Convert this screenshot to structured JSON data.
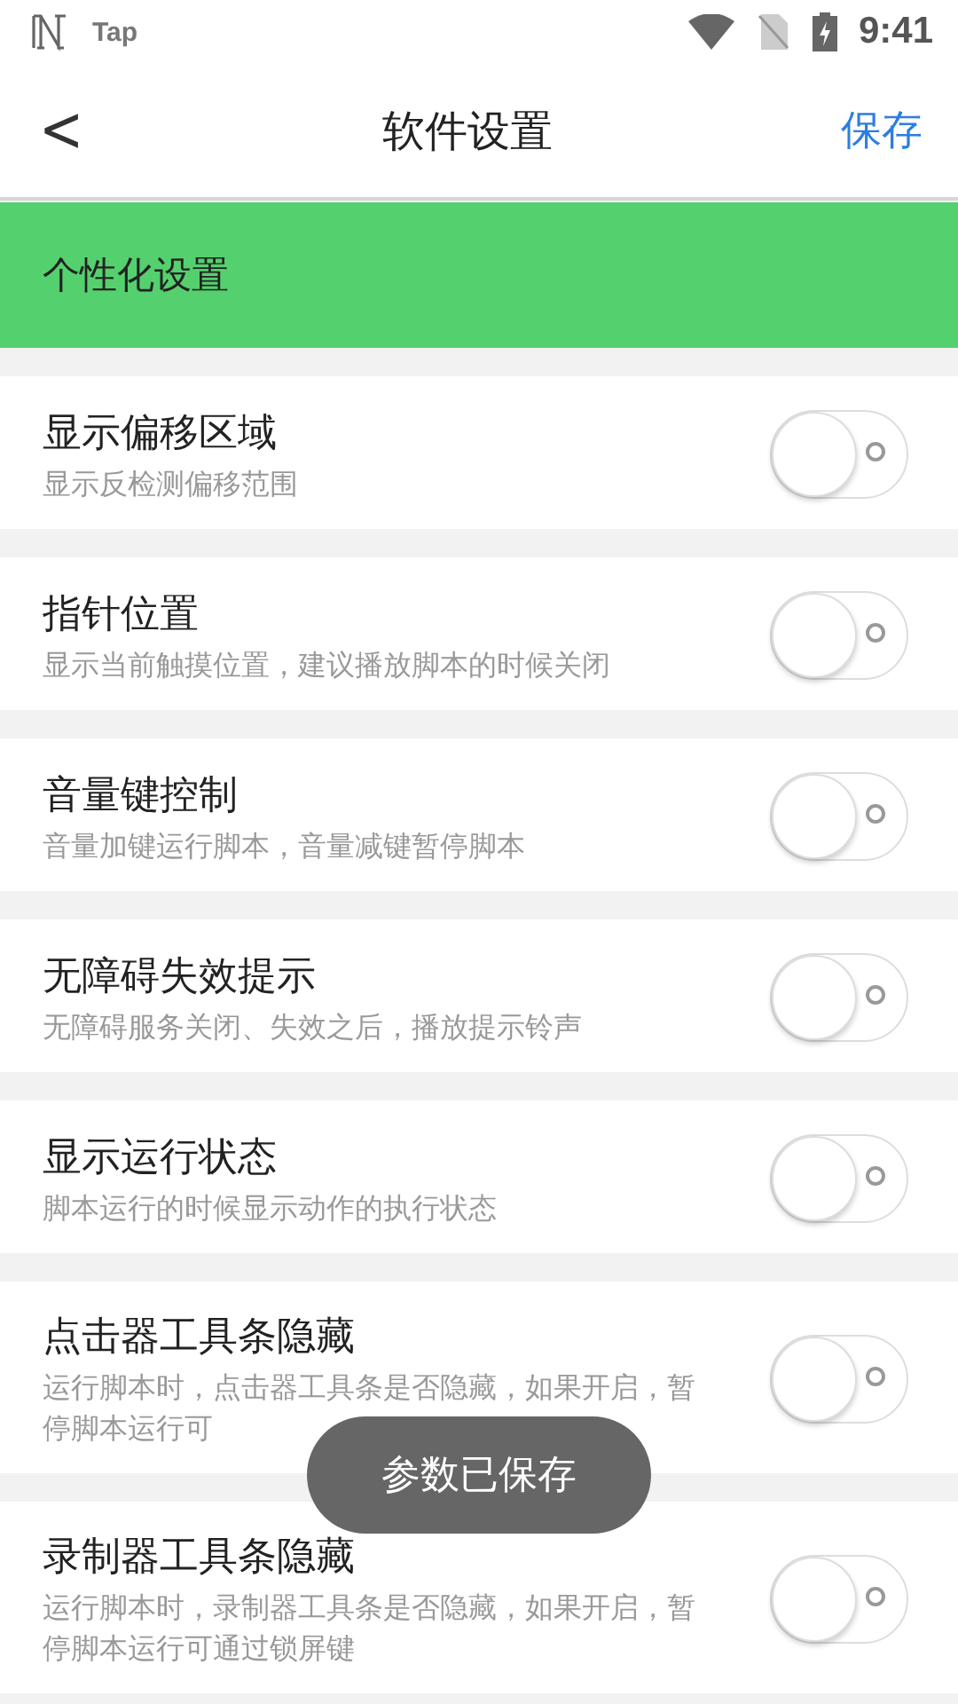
{
  "status_bar": {
    "app": "Tap",
    "time": "9:41"
  },
  "header": {
    "back": "<",
    "title": "软件设置",
    "action": "保存"
  },
  "section": {
    "title": "个性化设置"
  },
  "settings": [
    {
      "title": "显示偏移区域",
      "description": "显示反检测偏移范围",
      "on": false
    },
    {
      "title": "指针位置",
      "description": "显示当前触摸位置，建议播放脚本的时候关闭",
      "on": false
    },
    {
      "title": "音量键控制",
      "description": "音量加键运行脚本，音量减键暂停脚本",
      "on": false
    },
    {
      "title": "无障碍失效提示",
      "description": "无障碍服务关闭、失效之后，播放提示铃声",
      "on": false
    },
    {
      "title": "显示运行状态",
      "description": "脚本运行的时候显示动作的执行状态",
      "on": false
    },
    {
      "title": "点击器工具条隐藏",
      "description": "运行脚本时，点击器工具条是否隐藏，如果开启，暂停脚本运行可",
      "on": false
    },
    {
      "title": "录制器工具条隐藏",
      "description": "运行脚本时，录制器工具条是否隐藏，如果开启，暂停脚本运行可通过锁屏键",
      "on": false
    }
  ],
  "toast": "参数已保存"
}
